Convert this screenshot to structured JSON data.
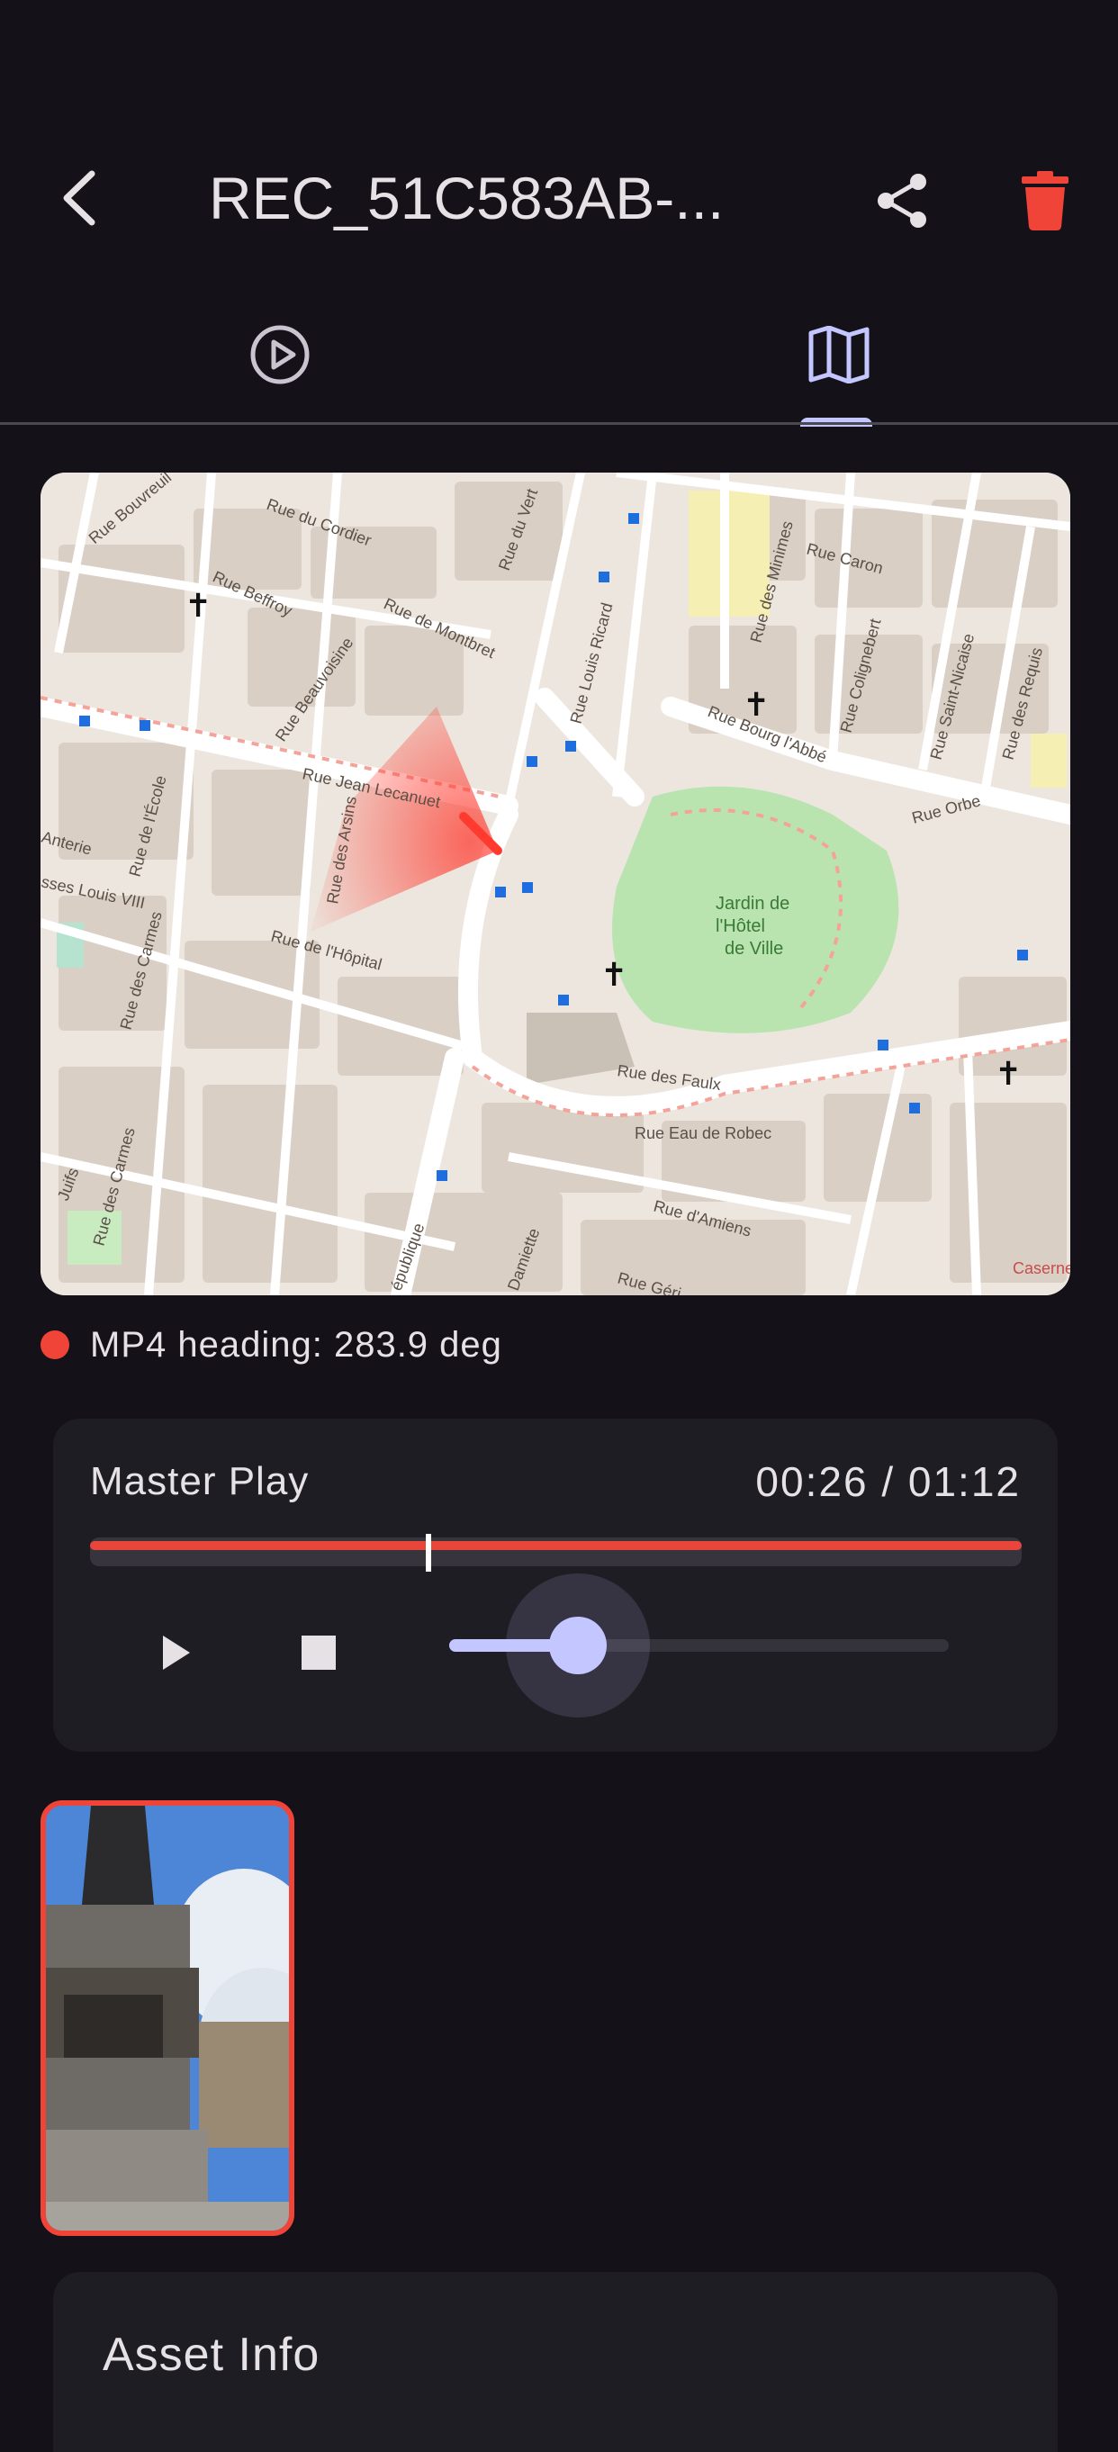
{
  "app_bar": {
    "title": "REC_51C583AB-...",
    "back_icon": "arrow-back-icon",
    "share_icon": "share-icon",
    "delete_icon": "trash-icon",
    "delete_color": "#f04438"
  },
  "tabs": [
    {
      "name": "player",
      "icon": "play-circle-icon",
      "selected": false
    },
    {
      "name": "map",
      "icon": "map-icon",
      "selected": true
    }
  ],
  "map": {
    "street_labels": [
      "Rue Bouvreuil",
      "Rue du Cordier",
      "Rue des",
      "Rue du Vert",
      "Rue Caron",
      "Rue des Minimes",
      "Rue Beffroy",
      "Rue de Montbret",
      "Rue Louis Ricard",
      "Rue Beauvoisine",
      "Rue Bourg l'Abbé",
      "Rue Colignebert",
      "Rue Saint-Nicaise",
      "Rue des Requis",
      "Rue Jean Lecanuet",
      "Rue de l'École",
      "Rue Orbe",
      "Anterie",
      "Rue des Arsins",
      "sses Louis VIII",
      "Rue des Carmes",
      "Rue de l'Hôpital",
      "Jardin de l'Hôtel de Ville",
      "Rue des Faulx",
      "Rue Eau de Robec",
      "Juifs",
      "Rue des Carmes",
      "Rue d'Amiens",
      "Rue Géri",
      "Damiette",
      "épublique",
      "Caserne"
    ],
    "heading_deg": 283.9
  },
  "heading": {
    "text": "MP4 heading: 283.9 deg",
    "dot_color": "#f04438"
  },
  "master_play": {
    "title": "Master Play",
    "time": "00:26 / 01:12",
    "progress": 0.36,
    "play_icon": "play-icon",
    "stop_icon": "stop-icon",
    "volume": 0.2
  },
  "thumbnail": {
    "icon": "video-thumbnail",
    "selected": true
  },
  "asset_info": {
    "title": "Asset Info"
  }
}
